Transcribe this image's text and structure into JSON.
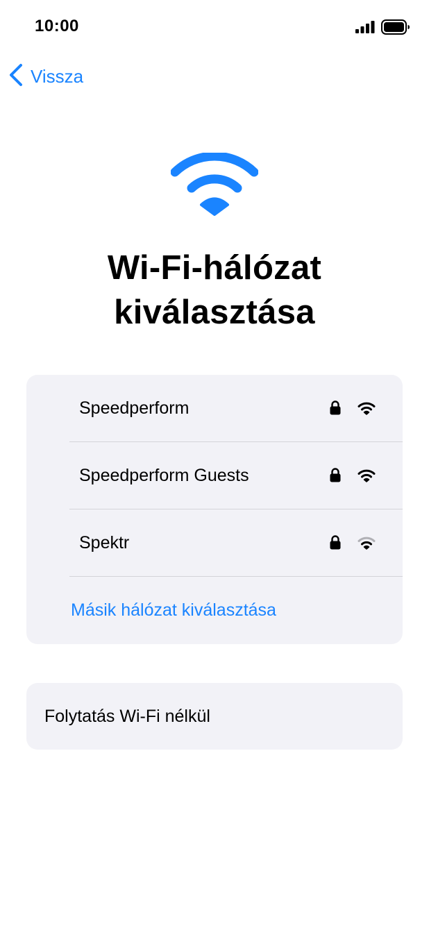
{
  "status_bar": {
    "time": "10:00",
    "signal_icon": "cellular-signal-icon",
    "battery_icon": "battery-full-icon"
  },
  "nav": {
    "back_label": "Vissza",
    "back_icon": "chevron-left-icon"
  },
  "hero": {
    "icon": "wifi-icon",
    "title_line1": "Wi-Fi-hálózat",
    "title_line2": "kiválasztása"
  },
  "networks": [
    {
      "name": "Speedperform",
      "secured": true,
      "signal": "full"
    },
    {
      "name": "Speedperform Guests",
      "secured": true,
      "signal": "full"
    },
    {
      "name": "Spektr",
      "secured": true,
      "signal": "weak"
    }
  ],
  "other_network_label": "Másik hálózat kiválasztása",
  "continue_without_wifi_label": "Folytatás Wi-Fi nélkül",
  "colors": {
    "accent": "#1a84ff",
    "card_background": "#f2f2f7",
    "text": "#000000"
  }
}
